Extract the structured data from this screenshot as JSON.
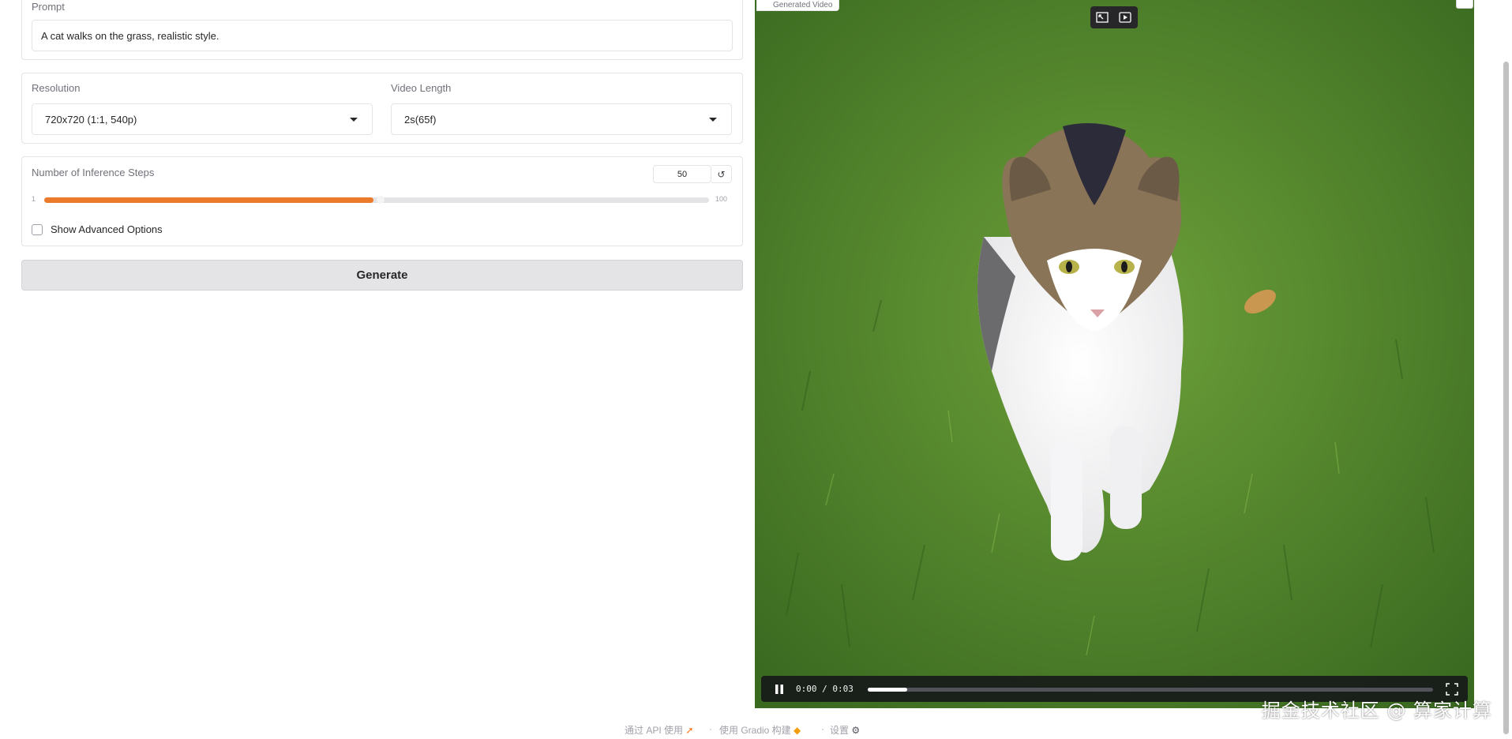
{
  "prompt": {
    "label": "Prompt",
    "value": "A cat walks on the grass, realistic style."
  },
  "resolution": {
    "label": "Resolution",
    "value": "720x720 (1:1, 540p)"
  },
  "video_length": {
    "label": "Video Length",
    "value": "2s(65f)"
  },
  "inference_steps": {
    "label": "Number of Inference Steps",
    "value": "50",
    "min": "1",
    "max": "100",
    "fraction": 0.495,
    "reset_glyph": "↺"
  },
  "advanced": {
    "label": "Show Advanced Options",
    "checked": false
  },
  "generate_button": "Generate",
  "video": {
    "label": "Generated Video",
    "time": "0:00 / 0:03",
    "progress_fraction": 0.07,
    "pause_icon": "pause-icon",
    "fullscreen_icon": "fullscreen-icon"
  },
  "footer": {
    "api": "通过 API 使用",
    "sep1": "·",
    "built": "使用 Gradio 构建",
    "sep2": "·",
    "settings": "设置"
  },
  "watermark": "掘金技术社区 @ 算家计算",
  "colors": {
    "accent": "#ea7a2c",
    "button_bg": "#e4e4e7",
    "border": "#e4e4e7"
  }
}
